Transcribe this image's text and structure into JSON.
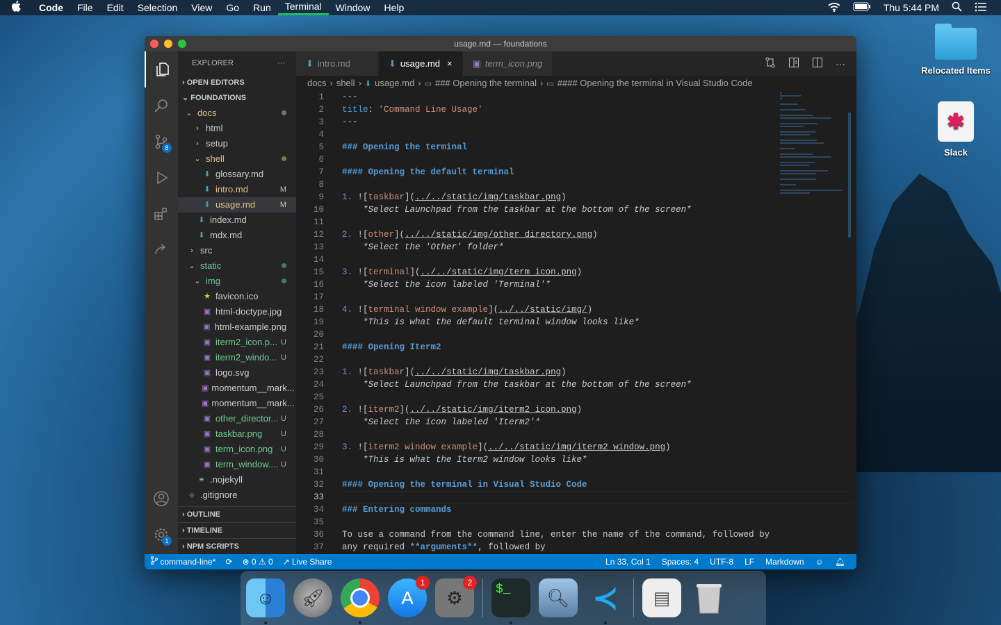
{
  "menubar": {
    "apple": "",
    "items": [
      "Code",
      "File",
      "Edit",
      "Selection",
      "View",
      "Go",
      "Run",
      "Terminal",
      "Window",
      "Help"
    ],
    "clock": "Thu 5:44 PM"
  },
  "desktop": {
    "folder_label": "Relocated Items",
    "slack_label": "Slack"
  },
  "window": {
    "title": "usage.md — foundations"
  },
  "activity": {
    "scm_badge": "8",
    "settings_badge": "1"
  },
  "sidebar": {
    "header": "EXPLORER",
    "more": "···",
    "open_editors": "OPEN EDITORS",
    "workspace": "FOUNDATIONS",
    "tree": [
      {
        "chev": "⌄",
        "icon": "",
        "label": "docs",
        "status": "dot",
        "cls": "mod",
        "indent": 8
      },
      {
        "chev": "›",
        "icon": "",
        "label": "html",
        "status": "",
        "cls": "",
        "indent": 20
      },
      {
        "chev": "›",
        "icon": "",
        "label": "setup",
        "status": "",
        "cls": "",
        "indent": 20
      },
      {
        "chev": "⌄",
        "icon": "",
        "label": "shell",
        "status": "dot",
        "cls": "mod",
        "indent": 20
      },
      {
        "chev": "",
        "icon": "md",
        "label": "glossary.md",
        "status": "",
        "cls": "",
        "indent": 34
      },
      {
        "chev": "",
        "icon": "md",
        "label": "intro.md",
        "status": "M",
        "cls": "mod",
        "indent": 34
      },
      {
        "chev": "",
        "icon": "md",
        "label": "usage.md",
        "status": "M",
        "cls": "mod",
        "indent": 34,
        "sel": true
      },
      {
        "chev": "",
        "icon": "md",
        "label": "index.md",
        "status": "",
        "cls": "",
        "indent": 26
      },
      {
        "chev": "",
        "icon": "md",
        "label": "mdx.md",
        "status": "",
        "cls": "",
        "indent": 26
      },
      {
        "chev": "›",
        "icon": "",
        "label": "src",
        "status": "",
        "cls": "",
        "indent": 12
      },
      {
        "chev": "⌄",
        "icon": "",
        "label": "static",
        "status": "dotg",
        "cls": "unt",
        "indent": 12
      },
      {
        "chev": "⌄",
        "icon": "",
        "label": "img",
        "status": "dotg",
        "cls": "unt",
        "indent": 20
      },
      {
        "chev": "",
        "icon": "star",
        "label": "favicon.ico",
        "status": "",
        "cls": "",
        "indent": 34
      },
      {
        "chev": "",
        "icon": "img",
        "label": "html-doctype.jpg",
        "status": "",
        "cls": "",
        "indent": 34
      },
      {
        "chev": "",
        "icon": "img",
        "label": "html-example.png",
        "status": "",
        "cls": "",
        "indent": 34
      },
      {
        "chev": "",
        "icon": "img",
        "label": "iterm2_icon.p...",
        "status": "U",
        "cls": "unt",
        "indent": 34
      },
      {
        "chev": "",
        "icon": "img",
        "label": "iterm2_windo...",
        "status": "U",
        "cls": "unt",
        "indent": 34
      },
      {
        "chev": "",
        "icon": "img",
        "label": "logo.svg",
        "status": "",
        "cls": "",
        "indent": 34
      },
      {
        "chev": "",
        "icon": "img",
        "label": "momentum__mark...",
        "status": "",
        "cls": "",
        "indent": 34
      },
      {
        "chev": "",
        "icon": "img",
        "label": "momentum__mark...",
        "status": "",
        "cls": "",
        "indent": 34
      },
      {
        "chev": "",
        "icon": "img",
        "label": "other_director...",
        "status": "U",
        "cls": "unt",
        "indent": 34
      },
      {
        "chev": "",
        "icon": "img",
        "label": "taskbar.png",
        "status": "U",
        "cls": "unt",
        "indent": 34
      },
      {
        "chev": "",
        "icon": "img",
        "label": "term_icon.png",
        "status": "U",
        "cls": "unt",
        "indent": 34
      },
      {
        "chev": "",
        "icon": "img",
        "label": "term_window....",
        "status": "U",
        "cls": "unt",
        "indent": 34
      },
      {
        "chev": "",
        "icon": "list",
        "label": ".nojekyll",
        "status": "",
        "cls": "",
        "indent": 26
      },
      {
        "chev": "",
        "icon": "diamond",
        "label": ".gitignore",
        "status": "",
        "cls": "",
        "indent": 12
      }
    ],
    "outline": "OUTLINE",
    "timeline": "TIMELINE",
    "npm": "NPM SCRIPTS"
  },
  "tabs": [
    {
      "label": "intro.md",
      "icon": "md",
      "active": false,
      "preview": false
    },
    {
      "label": "usage.md",
      "icon": "md",
      "active": true,
      "preview": false,
      "close": "×"
    },
    {
      "label": "term_icon.png",
      "icon": "img",
      "active": false,
      "preview": true
    }
  ],
  "breadcrumbs": [
    "docs",
    "shell",
    "usage.md",
    "### Opening the terminal",
    "#### Opening the terminal in Visual Studio Code"
  ],
  "editor": {
    "current_line": 33,
    "lines": [
      [
        [
          "---",
          "#cccccc"
        ]
      ],
      [
        [
          "title",
          "#569cd6"
        ],
        [
          ": ",
          "#cccccc"
        ],
        [
          "'Command Line Usage'",
          "#ce9178"
        ]
      ],
      [
        [
          "---",
          "#cccccc"
        ]
      ],
      [],
      [
        [
          "### Opening the terminal",
          "#569cd6",
          "b"
        ]
      ],
      [],
      [
        [
          "#### Opening the default terminal",
          "#569cd6",
          "b"
        ]
      ],
      [],
      [
        [
          "1. ",
          "#6796e6"
        ],
        [
          "![",
          "#cccccc"
        ],
        [
          "taskbar",
          "#ce9178"
        ],
        [
          "](",
          "#cccccc"
        ],
        [
          "../../static/img/taskbar.png",
          "#cccccc",
          "u"
        ],
        [
          ")",
          "#cccccc"
        ]
      ],
      [
        [
          "    *Select Launchpad from the taskbar at the bottom of the screen*",
          "#cccccc",
          "i"
        ]
      ],
      [],
      [
        [
          "2. ",
          "#6796e6"
        ],
        [
          "![",
          "#cccccc"
        ],
        [
          "other",
          "#ce9178"
        ],
        [
          "](",
          "#cccccc"
        ],
        [
          "../../static/img/other_directory.png",
          "#cccccc",
          "u"
        ],
        [
          ")",
          "#cccccc"
        ]
      ],
      [
        [
          "    *Select the 'Other' folder*",
          "#cccccc",
          "i"
        ]
      ],
      [],
      [
        [
          "3. ",
          "#6796e6"
        ],
        [
          "![",
          "#cccccc"
        ],
        [
          "terminal",
          "#ce9178"
        ],
        [
          "](",
          "#cccccc"
        ],
        [
          "../../static/img/term_icon.png",
          "#cccccc",
          "u"
        ],
        [
          ")",
          "#cccccc"
        ]
      ],
      [
        [
          "    *Select the icon labeled 'Terminal'*",
          "#cccccc",
          "i"
        ]
      ],
      [],
      [
        [
          "4. ",
          "#6796e6"
        ],
        [
          "![",
          "#cccccc"
        ],
        [
          "terminal window example",
          "#ce9178"
        ],
        [
          "](",
          "#cccccc"
        ],
        [
          "../../static/img/",
          "#cccccc",
          "u"
        ],
        [
          ")",
          "#cccccc"
        ]
      ],
      [
        [
          "    *This is what the default terminal window looks like*",
          "#cccccc",
          "i"
        ]
      ],
      [],
      [
        [
          "#### Opening Iterm2",
          "#569cd6",
          "b"
        ]
      ],
      [],
      [
        [
          "1. ",
          "#6796e6"
        ],
        [
          "![",
          "#cccccc"
        ],
        [
          "taskbar",
          "#ce9178"
        ],
        [
          "](",
          "#cccccc"
        ],
        [
          "../../static/img/taskbar.png",
          "#cccccc",
          "u"
        ],
        [
          ")",
          "#cccccc"
        ]
      ],
      [
        [
          "    *Select Launchpad from the taskbar at the bottom of the screen*",
          "#cccccc",
          "i"
        ]
      ],
      [],
      [
        [
          "2. ",
          "#6796e6"
        ],
        [
          "![",
          "#cccccc"
        ],
        [
          "iterm2",
          "#ce9178"
        ],
        [
          "](",
          "#cccccc"
        ],
        [
          "../../static/img/iterm2_icon.png",
          "#cccccc",
          "u"
        ],
        [
          ")",
          "#cccccc"
        ]
      ],
      [
        [
          "    *Select the icon labeled 'Iterm2'*",
          "#cccccc",
          "i"
        ]
      ],
      [],
      [
        [
          "3. ",
          "#6796e6"
        ],
        [
          "![",
          "#cccccc"
        ],
        [
          "iterm2 window example",
          "#ce9178"
        ],
        [
          "](",
          "#cccccc"
        ],
        [
          "../../static/img/iterm2_window.png",
          "#cccccc",
          "u"
        ],
        [
          ")",
          "#cccccc"
        ]
      ],
      [
        [
          "    *This is what the Iterm2 window looks like*",
          "#cccccc",
          "i"
        ]
      ],
      [],
      [
        [
          "#### Opening the terminal in Visual Studio Code",
          "#569cd6",
          "b"
        ]
      ],
      [],
      [
        [
          "### Entering commands",
          "#569cd6",
          "b"
        ]
      ],
      [],
      [
        [
          "To use a command from the command line, enter the name of the command, followed by",
          "#cccccc"
        ]
      ],
      [
        [
          "any required ",
          "#cccccc"
        ],
        [
          "**arguments**",
          "#569cd6",
          "b"
        ],
        [
          ", followed by",
          "#cccccc"
        ]
      ]
    ]
  },
  "statusbar": {
    "branch": "command-line*",
    "problems": "⊗ 0 ⚠ 0",
    "liveshare": "Live Share",
    "position": "Ln 33, Col 1",
    "spaces": "Spaces: 4",
    "encoding": "UTF-8",
    "eol": "LF",
    "language": "Markdown"
  },
  "dock": {
    "appstore_badge": "1",
    "prefs_badge": "2"
  }
}
